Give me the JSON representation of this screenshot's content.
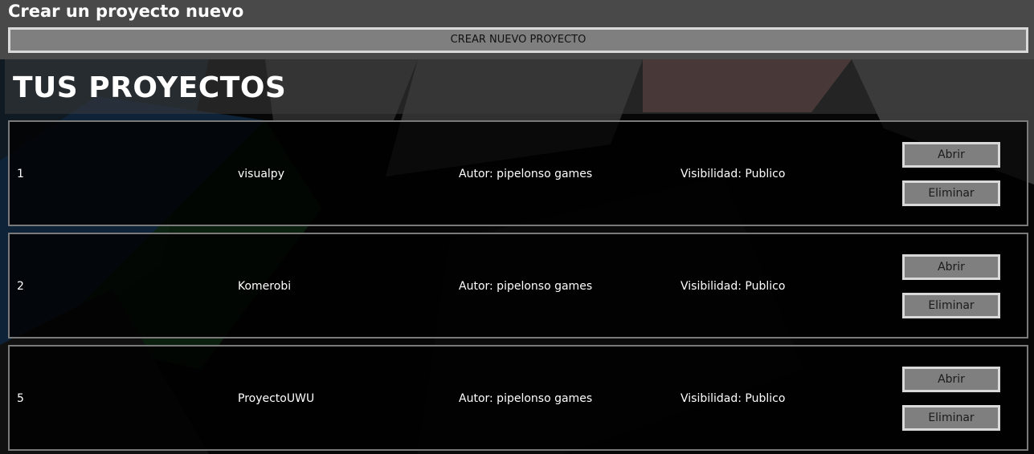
{
  "create": {
    "title": "Crear un proyecto nuevo",
    "button_label": "CREAR NUEVO PROYECTO"
  },
  "projects": {
    "title": "TUS PROYECTOS",
    "items": [
      {
        "id": "1",
        "name": "visualpy",
        "author": "Autor: pipelonso games",
        "visibility": "Visibilidad: Publico",
        "open_label": "Abrir",
        "delete_label": "Eliminar"
      },
      {
        "id": "2",
        "name": "Komerobi",
        "author": "Autor: pipelonso games",
        "visibility": "Visibilidad: Publico",
        "open_label": "Abrir",
        "delete_label": "Eliminar"
      },
      {
        "id": "5",
        "name": "ProyectoUWU",
        "author": "Autor: pipelonso games",
        "visibility": "Visibilidad: Publico",
        "open_label": "Abrir",
        "delete_label": "Eliminar"
      }
    ]
  },
  "colors": {
    "button_bg": "#7f7f7f",
    "button_border": "#d9d9d9",
    "card_border": "#7a7a7a",
    "header_bg": "#494949"
  }
}
